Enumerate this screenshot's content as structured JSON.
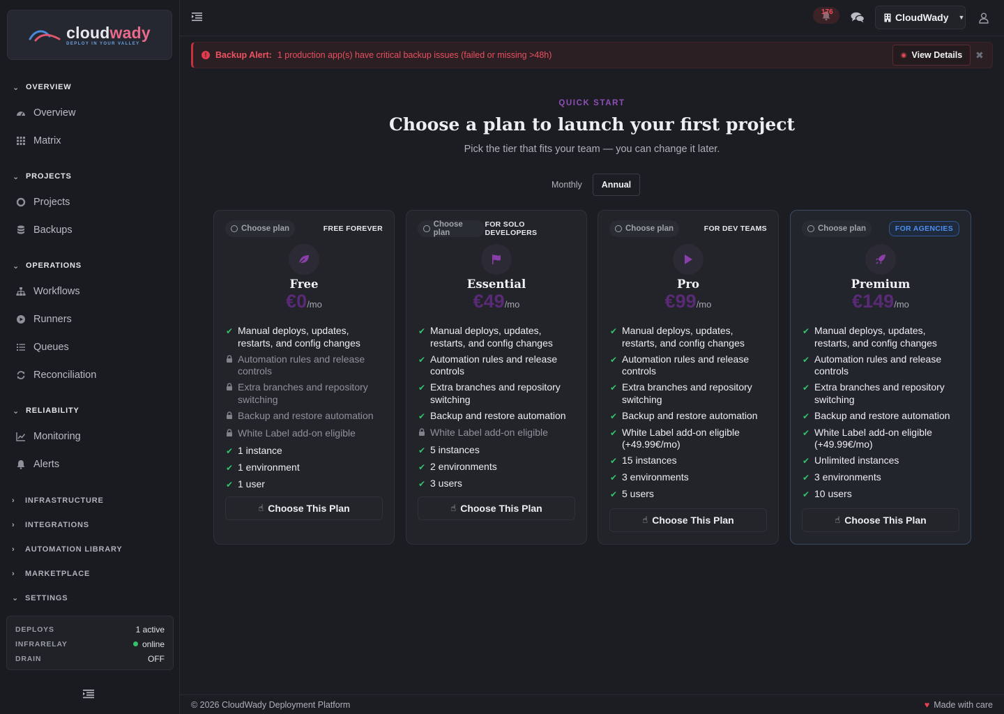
{
  "brand": {
    "name_part1": "cloud",
    "name_part2": "wady",
    "tagline": "DEPLOY IN YOUR VALLEY"
  },
  "nav": {
    "sections": [
      {
        "label": "OVERVIEW",
        "items": [
          {
            "label": "Overview",
            "icon": "dashboard-icon"
          },
          {
            "label": "Matrix",
            "icon": "grid-icon"
          }
        ]
      },
      {
        "label": "PROJECTS",
        "items": [
          {
            "label": "Projects",
            "icon": "circle-icon"
          },
          {
            "label": "Backups",
            "icon": "database-icon"
          }
        ]
      },
      {
        "label": "OPERATIONS",
        "items": [
          {
            "label": "Workflows",
            "icon": "sitemap-icon"
          },
          {
            "label": "Runners",
            "icon": "play-circle-icon"
          },
          {
            "label": "Queues",
            "icon": "list-icon"
          },
          {
            "label": "Reconciliation",
            "icon": "sync-icon"
          }
        ]
      },
      {
        "label": "RELIABILITY",
        "items": [
          {
            "label": "Monitoring",
            "icon": "chart-line-icon"
          },
          {
            "label": "Alerts",
            "icon": "bell-icon"
          }
        ]
      }
    ],
    "collapsed": [
      "INFRASTRUCTURE",
      "INTEGRATIONS",
      "AUTOMATION LIBRARY",
      "MARKETPLACE",
      "SETTINGS"
    ]
  },
  "status": {
    "deploys_label": "DEPLOYS",
    "deploys_value": "1 active",
    "relay_label": "INFRARELAY",
    "relay_value": "online",
    "drain_label": "DRAIN",
    "drain_value": "OFF"
  },
  "topbar": {
    "notifications_count": "176",
    "org_name": "CloudWady"
  },
  "alert": {
    "title": "Backup Alert:",
    "message": "1 production app(s) have critical backup issues (failed or missing >48h)",
    "action": "View Details"
  },
  "hero": {
    "kicker": "QUICK START",
    "title": "Choose a plan to launch your first project",
    "subtitle": "Pick the tier that fits your team — you can change it later."
  },
  "billing": {
    "monthly": "Monthly",
    "annual": "Annual",
    "selected": "Annual"
  },
  "plans": [
    {
      "choose_label": "Choose plan",
      "tag": "FREE FOREVER",
      "icon": "leaf-icon",
      "name": "Free",
      "price": "€0",
      "period": "/mo",
      "cta": "Choose This Plan",
      "features": [
        {
          "text": "Manual deploys, updates, restarts, and config changes",
          "included": true
        },
        {
          "text": "Automation rules and release controls",
          "included": false
        },
        {
          "text": "Extra branches and repository switching",
          "included": false
        },
        {
          "text": "Backup and restore automation",
          "included": false
        },
        {
          "text": "White Label add-on eligible",
          "included": false
        },
        {
          "text": "1 instance",
          "included": true
        },
        {
          "text": "1 environment",
          "included": true
        },
        {
          "text": "1 user",
          "included": true
        }
      ]
    },
    {
      "choose_label": "Choose plan",
      "tag": "FOR SOLO DEVELOPERS",
      "icon": "flag-icon",
      "name": "Essential",
      "price": "€49",
      "period": "/mo",
      "cta": "Choose This Plan",
      "features": [
        {
          "text": "Manual deploys, updates, restarts, and config changes",
          "included": true
        },
        {
          "text": "Automation rules and release controls",
          "included": true
        },
        {
          "text": "Extra branches and repository switching",
          "included": true
        },
        {
          "text": "Backup and restore automation",
          "included": true
        },
        {
          "text": "White Label add-on eligible",
          "included": false
        },
        {
          "text": "5 instances",
          "included": true
        },
        {
          "text": "2 environments",
          "included": true
        },
        {
          "text": "3 users",
          "included": true
        }
      ]
    },
    {
      "choose_label": "Choose plan",
      "tag": "FOR DEV TEAMS",
      "icon": "play-icon",
      "name": "Pro",
      "price": "€99",
      "period": "/mo",
      "cta": "Choose This Plan",
      "features": [
        {
          "text": "Manual deploys, updates, restarts, and config changes",
          "included": true
        },
        {
          "text": "Automation rules and release controls",
          "included": true
        },
        {
          "text": "Extra branches and repository switching",
          "included": true
        },
        {
          "text": "Backup and restore automation",
          "included": true
        },
        {
          "text": "White Label add-on eligible (+49.99€/mo)",
          "included": true
        },
        {
          "text": "15 instances",
          "included": true
        },
        {
          "text": "3 environments",
          "included": true
        },
        {
          "text": "5 users",
          "included": true
        }
      ]
    },
    {
      "choose_label": "Choose plan",
      "tag": "FOR AGENCIES",
      "icon": "rocket-icon",
      "name": "Premium",
      "price": "€149",
      "period": "/mo",
      "cta": "Choose This Plan",
      "features": [
        {
          "text": "Manual deploys, updates, restarts, and config changes",
          "included": true
        },
        {
          "text": "Automation rules and release controls",
          "included": true
        },
        {
          "text": "Extra branches and repository switching",
          "included": true
        },
        {
          "text": "Backup and restore automation",
          "included": true
        },
        {
          "text": "White Label add-on eligible (+49.99€/mo)",
          "included": true
        },
        {
          "text": "Unlimited instances",
          "included": true
        },
        {
          "text": "3 environments",
          "included": true
        },
        {
          "text": "10 users",
          "included": true
        }
      ]
    }
  ],
  "footer": {
    "copyright": "© 2026 CloudWady Deployment Platform",
    "made_with": "Made with care"
  }
}
